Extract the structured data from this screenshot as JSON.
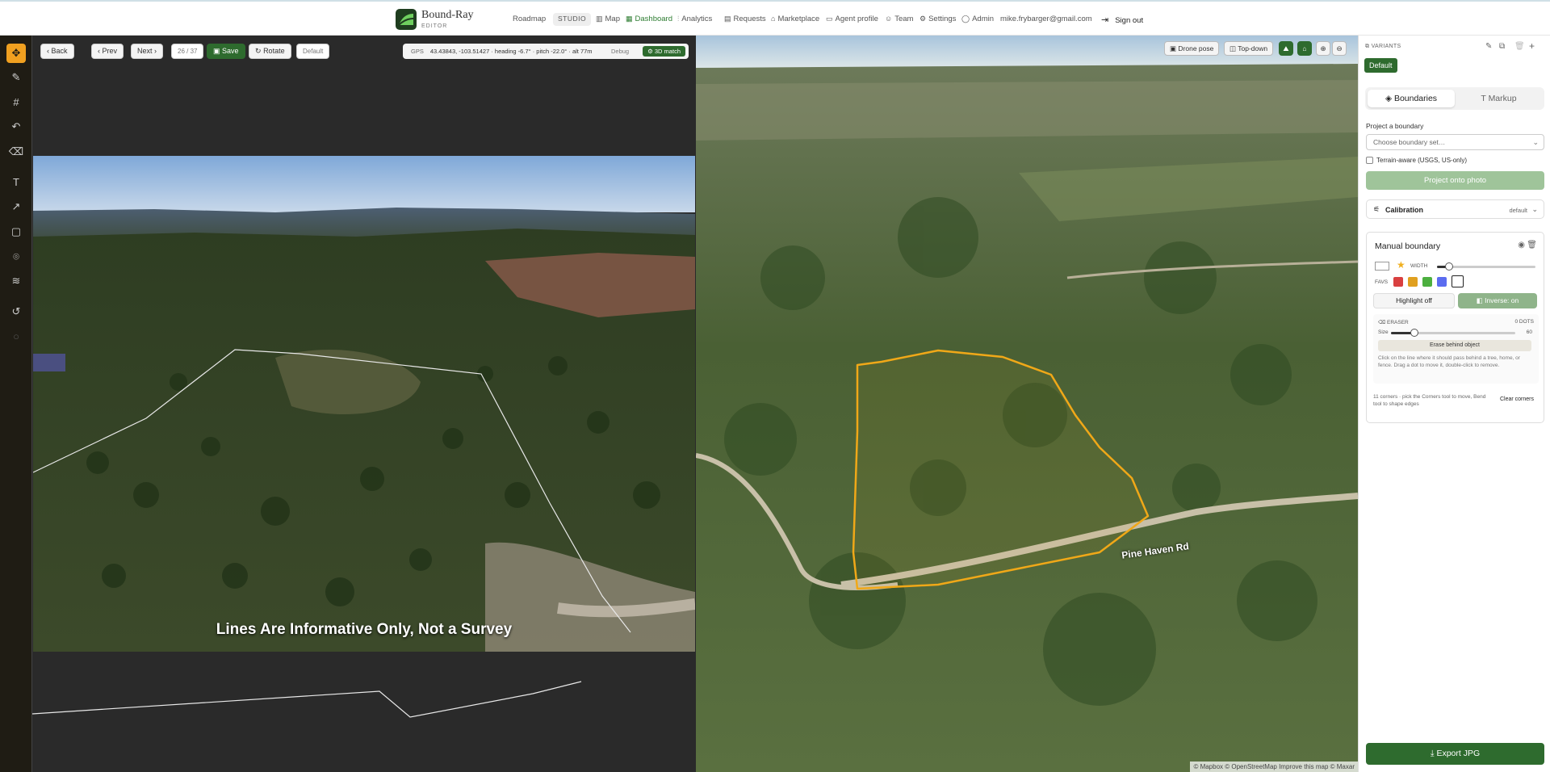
{
  "app": {
    "brand": "Bound-Ray",
    "brand_sub": "EDITOR",
    "studio_label": "STUDIO"
  },
  "nav": [
    {
      "label": "Roadmap",
      "icon": ""
    },
    {
      "label": "Map",
      "icon": "map-icon"
    },
    {
      "label": "Dashboard",
      "icon": "dashboard-icon"
    },
    {
      "label": "Analytics",
      "icon": "analytics-icon"
    },
    {
      "label": "Requests",
      "icon": "requests-icon"
    },
    {
      "label": "Marketplace",
      "icon": "marketplace-icon"
    },
    {
      "label": "Agent profile",
      "icon": "agent-icon"
    },
    {
      "label": "Team",
      "icon": "team-icon"
    },
    {
      "label": "Settings",
      "icon": "gear-icon"
    },
    {
      "label": "Admin",
      "icon": "shield-icon"
    }
  ],
  "user": {
    "email": "mike.frybarger@gmail.com",
    "signout": "Sign out"
  },
  "photo_toolbar": {
    "back": "Back",
    "prev": "Prev",
    "next": "Next",
    "counter": "26 / 37",
    "save": "Save",
    "rotate": "Rotate",
    "default": "Default"
  },
  "gps": {
    "label": "GPS",
    "value": "43.43843, -103.51427 · heading -6.7° · pitch -22.0° · alt 77m",
    "debug": "Debug",
    "match": "3D match"
  },
  "photo": {
    "disclaimer": "Lines Are Informative Only, Not a Survey"
  },
  "map": {
    "drone_pose": "Drone pose",
    "top_down": "Top-down",
    "road_label": "Pine Haven Rd",
    "attribution": "© Mapbox © OpenStreetMap  Improve this map © Maxar"
  },
  "panel": {
    "variants_label": "VARIANTS",
    "variant_default": "Default",
    "tab_boundaries": "Boundaries",
    "tab_markup": "Markup",
    "project_label": "Project a boundary",
    "project_placeholder": "Choose boundary set…",
    "terrain_label": "Terrain-aware (USGS, US-only)",
    "project_button": "Project onto photo",
    "calibration_label": "Calibration",
    "calibration_value": "default",
    "manual_title": "Manual boundary",
    "width_label": "WIDTH",
    "favs_label": "FAVS",
    "fav_colors": [
      "#d94040",
      "#e0a020",
      "#4caf3f",
      "#5b6cf0",
      "#ffffff"
    ],
    "highlight_button": "Highlight off",
    "inverse_button": "Inverse: on",
    "eraser_label": "ERASER",
    "eraser_dots": "0 DOTS",
    "size_label": "Size",
    "size_value": "60",
    "erase_button": "Erase behind object",
    "eraser_help": "Click on the line where it should pass behind a tree, home, or fence. Drag a dot to move it, double-click to remove.",
    "corners_help": "11 corners · pick the Corners tool to move, Bend tool to shape edges",
    "clear_corners": "Clear corners",
    "export": "Export JPG"
  },
  "colors": {
    "accent": "#2e6b2e",
    "tool_active": "#f0a020",
    "boundary": "#f0a818"
  }
}
